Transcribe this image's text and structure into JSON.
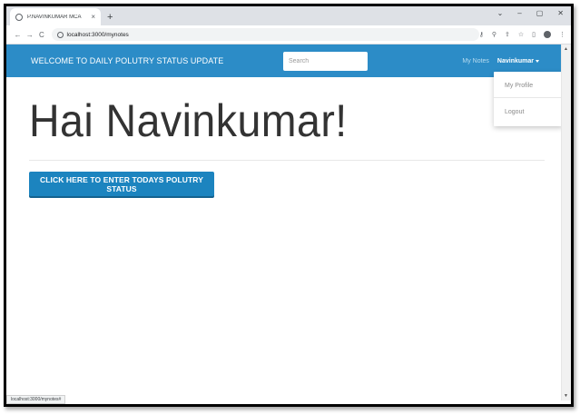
{
  "browser": {
    "tab_title": "P.NAVINKUMAR MCA",
    "tab_close": "×",
    "new_tab": "+",
    "window_controls": [
      "⌄",
      "–",
      "▢",
      "✕"
    ],
    "nav": {
      "back": "←",
      "forward": "→",
      "reload": "C"
    },
    "url": "localhost:3000/mynotes",
    "toolbar_icons": [
      "key-icon",
      "zoom-icon",
      "share-icon",
      "star-icon",
      "sidepanel-icon",
      "profile-icon",
      "menu-icon"
    ],
    "status_url": "localhost:3000/mynotes#"
  },
  "app": {
    "brand": "WELCOME TO DAILY POLUTRY STATUS UPDATE",
    "search_placeholder": "Search",
    "nav_link": "My Notes",
    "user_name": "Navinkumar",
    "dropdown": {
      "profile": "My Profile",
      "logout": "Logout"
    },
    "greeting": "Hai Navinkumar!",
    "cta_label": "CLICK HERE TO ENTER TODAYS POLUTRY STATUS",
    "colors": {
      "navbar": "#2c8cc7",
      "button": "#1c84bf"
    }
  }
}
